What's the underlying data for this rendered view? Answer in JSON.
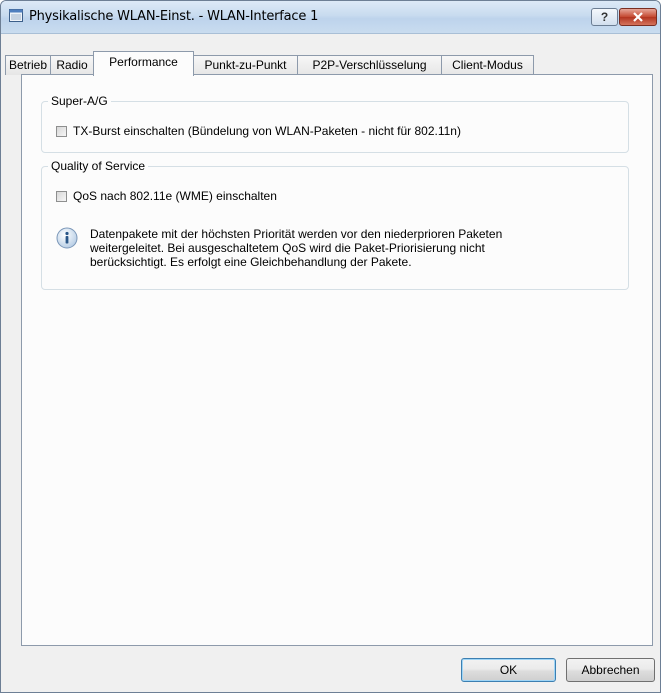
{
  "window": {
    "title": "Physikalische WLAN-Einst. - WLAN-Interface 1",
    "help_label": "?"
  },
  "tabs": [
    {
      "label": "Betrieb"
    },
    {
      "label": "Radio"
    },
    {
      "label": "Performance",
      "active": true
    },
    {
      "label": "Punkt-zu-Punkt"
    },
    {
      "label": "P2P-Verschlüsselung"
    },
    {
      "label": "Client-Modus"
    }
  ],
  "super_ag": {
    "legend": "Super-A/G",
    "txburst_label": "TX-Burst einschalten (Bündelung von WLAN-Paketen - nicht für 802.11n)",
    "txburst_checked": false
  },
  "qos": {
    "legend": "Quality of Service",
    "wme_label": "QoS nach 802.11e (WME) einschalten",
    "wme_checked": false,
    "info_line1": "Datenpakete mit der höchsten Priorität werden vor den niederprioren Paketen",
    "info_line2": "weitergeleitet. Bei ausgeschaltetem QoS wird die Paket-Priorisierung nicht",
    "info_line3": "berücksichtigt. Es erfolgt eine Gleichbehandlung der Pakete."
  },
  "footer": {
    "ok_label": "OK",
    "cancel_label": "Abbrechen"
  },
  "icons": {
    "window": "window-icon",
    "help": "help-icon",
    "close": "close-icon",
    "info": "info-icon"
  }
}
